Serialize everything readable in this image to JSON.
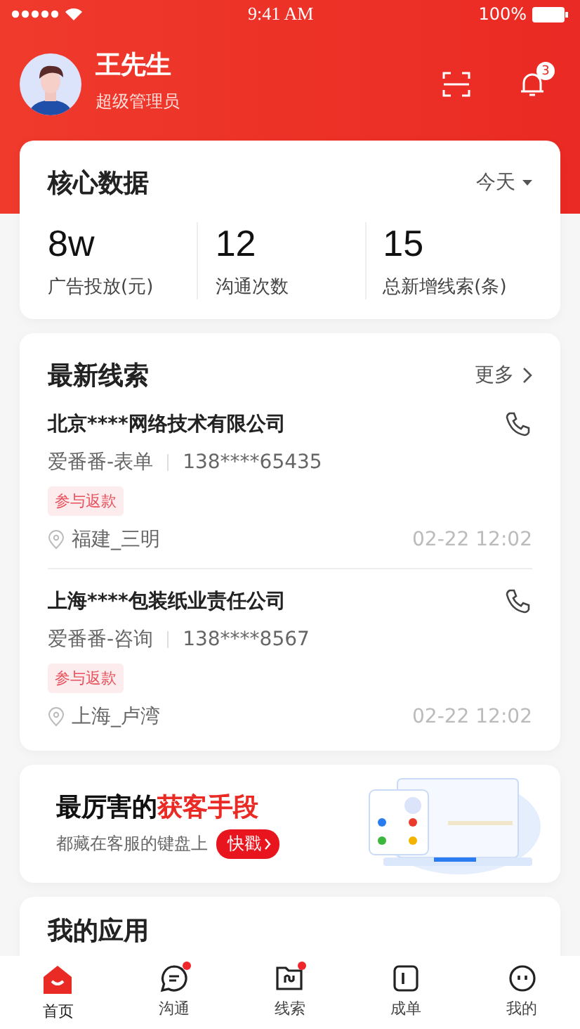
{
  "status_bar": {
    "time": "9:41 AM",
    "battery": "100%"
  },
  "profile": {
    "name": "王先生",
    "role": "超级管理员",
    "notification_count": "3"
  },
  "core_data": {
    "title": "核心数据",
    "period": "今天",
    "stats": [
      {
        "value": "8w",
        "label": "广告投放(元)"
      },
      {
        "value": "12",
        "label": "沟通次数"
      },
      {
        "value": "15",
        "label": "总新增线索(条)"
      }
    ]
  },
  "leads": {
    "title": "最新线索",
    "more": "更多",
    "items": [
      {
        "company": "北京****网络技术有限公司",
        "source": "爱番番-表单",
        "phone": "138****65435",
        "tag": "参与返款",
        "location": "福建_三明",
        "time": "02-22 12:02"
      },
      {
        "company": "上海****包装纸业责任公司",
        "source": "爱番番-咨询",
        "phone": "138****8567",
        "tag": "参与返款",
        "location": "上海_卢湾",
        "time": "02-22 12:02"
      }
    ]
  },
  "banner": {
    "title": "最厉害的**获客手段**",
    "subtitle": "都藏在客服的键盘上",
    "button": "快戳"
  },
  "apps": {
    "title": "我的应用"
  },
  "tab_bar": [
    {
      "label": "首页",
      "kind": "home",
      "selected": true,
      "dot": false
    },
    {
      "label": "沟通",
      "kind": "chat",
      "selected": false,
      "dot": true
    },
    {
      "label": "线索",
      "kind": "folder",
      "selected": false,
      "dot": true
    },
    {
      "label": "成单",
      "kind": "order",
      "selected": false,
      "dot": false
    },
    {
      "label": "我的",
      "kind": "face",
      "selected": false,
      "dot": false
    }
  ]
}
